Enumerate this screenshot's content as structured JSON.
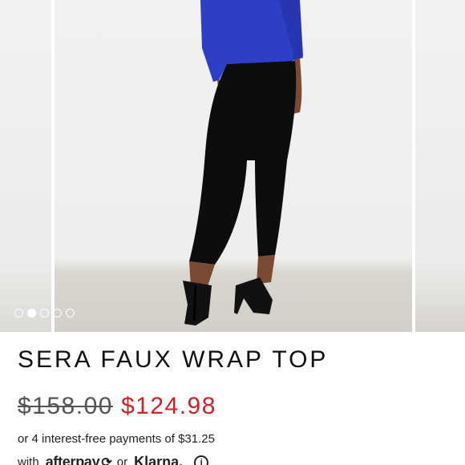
{
  "carousel": {
    "image_alt": "",
    "dots": [
      {
        "active": false
      },
      {
        "active": true
      },
      {
        "active": false
      },
      {
        "active": false
      },
      {
        "active": false
      }
    ]
  },
  "product": {
    "title": "SERA FAUX WRAP TOP",
    "original_price": "$158.00",
    "sale_price": "$124.98"
  },
  "payment": {
    "installments_text": "or 4 interest-free payments of $31.25",
    "with_text": "with",
    "afterpay_label": "afterpay",
    "afterpay_arrow": "⟳",
    "or_text": "or",
    "klarna_label": "Klarna.",
    "info_label": "i"
  },
  "colors": {
    "sale_price": "#d31f26",
    "top": "#2d3fc7",
    "pants": "#0d0d0d"
  }
}
